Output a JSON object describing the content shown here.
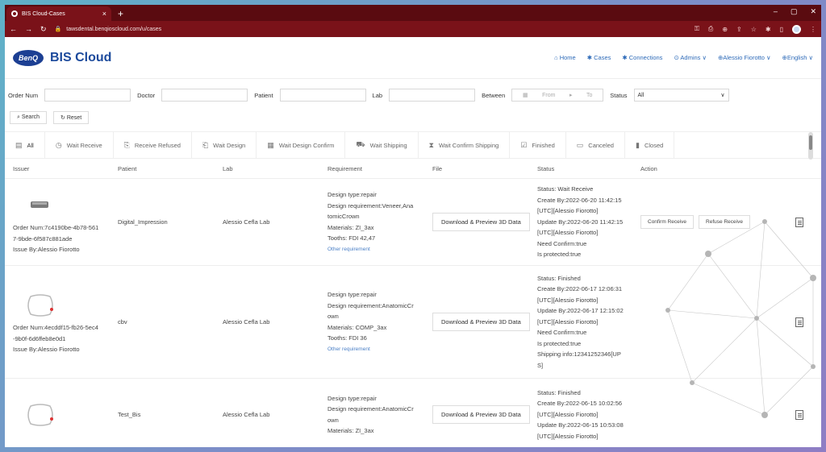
{
  "browser": {
    "tab_title": "BIS Cloud-Cases",
    "tab_close": "×",
    "new_tab": "+",
    "url": "tawsdental.benqioscloud.com/u/cases",
    "win_min": "–",
    "win_max": "▢",
    "win_close": "✕"
  },
  "app": {
    "logo_text": "BenQ",
    "name": "BIS Cloud",
    "nav": {
      "home": "⌂ Home",
      "cases": "✱ Cases",
      "connections": "✱ Connections",
      "admins": "⊙ Admins ∨",
      "user": "⊕Alessio Fiorotto ∨",
      "language": "⊕English ∨"
    }
  },
  "filters": {
    "order_num": "Order Num",
    "doctor": "Doctor",
    "patient": "Patient",
    "lab": "Lab",
    "between": "Between",
    "from": "From",
    "to": "To",
    "range_sep": "▸",
    "status": "Status",
    "status_value": "All",
    "search": "⌕ Search",
    "reset": "↻ Reset"
  },
  "status_tabs": [
    {
      "icon": "▤",
      "label": "All"
    },
    {
      "icon": "◷",
      "label": "Wait Receive"
    },
    {
      "icon": "⎘",
      "label": "Receive Refused"
    },
    {
      "icon": "⎗",
      "label": "Wait Design"
    },
    {
      "icon": "▦",
      "label": "Wait Design Confirm"
    },
    {
      "icon": "⛟",
      "label": "Wait Shipping"
    },
    {
      "icon": "⧗",
      "label": "Wait Confirm Shipping"
    },
    {
      "icon": "☑",
      "label": "Finished"
    },
    {
      "icon": "▭",
      "label": "Canceled"
    },
    {
      "icon": "▮",
      "label": "Closed"
    }
  ],
  "table": {
    "headers": [
      "Issuer",
      "Patient",
      "Lab",
      "Requirement",
      "File",
      "Status",
      "Action"
    ],
    "rows": [
      {
        "issuer": [
          "Order Num:7c4190be-4b78-561",
          "7-9bde-6f587c881ade",
          "Issue By:Alessio Fiorotto"
        ],
        "patient": "Digital_Impression",
        "lab": "Alessio Cefla Lab",
        "req": [
          "Design type:repair",
          "Design requirement:Veneer,Ana",
          "tomicCrown",
          "Materials: ZI_3ax",
          "Tooths: FDI 42,47"
        ],
        "req_link": "Other requirement",
        "file": "Download & Preview 3D Data",
        "status": [
          "Status: Wait Receive",
          "Create By:2022-06-20 11:42:15",
          "[UTC][Alessio Fiorotto]",
          "Update By:2022-06-20 11:42:15",
          "[UTC][Alessio Fiorotto]",
          "Need Confirm:true",
          "Is protected:true"
        ],
        "actions": [
          "Confirm Receive",
          "Refuse Receive"
        ]
      },
      {
        "issuer": [
          "Order Num:4ecddf15-fb26-5ec4",
          "-9b0f-6d6ffeb8e0d1",
          "Issue By:Alessio Fiorotto"
        ],
        "patient": "cbv",
        "lab": "Alessio Cefla Lab",
        "req": [
          "Design type:repair",
          "Design requirement:AnatomicCr",
          "own",
          "Materials: COMP_3ax",
          "Tooths: FDI 36"
        ],
        "req_link": "Other requirement",
        "file": "Download & Preview 3D Data",
        "status": [
          "Status: Finished",
          "Create By:2022-06-17 12:06:31",
          "[UTC][Alessio Fiorotto]",
          "Update By:2022-06-17 12:15:02",
          "[UTC][Alessio Fiorotto]",
          "Need Confirm:true",
          "Is protected:true",
          "Shipping info:12341252346[UP",
          "S]"
        ],
        "actions": []
      },
      {
        "issuer": [],
        "patient": "Test_Bis",
        "lab": "Alessio Cefla Lab",
        "req": [
          "Design type:repair",
          "Design requirement:AnatomicCr",
          "own",
          "Materials: ZI_3ax"
        ],
        "req_link": "",
        "file": "Download & Preview 3D Data",
        "status": [
          "Status: Finished",
          "Create By:2022-06-15 10:02:56",
          "[UTC][Alessio Fiorotto]",
          "Update By:2022-06-15 10:53:08",
          "[UTC][Alessio Fiorotto]"
        ],
        "actions": []
      }
    ]
  },
  "colors": {
    "browser_dark": "#5a0b10",
    "browser_bar": "#7a1219",
    "brand_blue": "#1c4a9c",
    "nav_blue": "#2d6ab8"
  }
}
